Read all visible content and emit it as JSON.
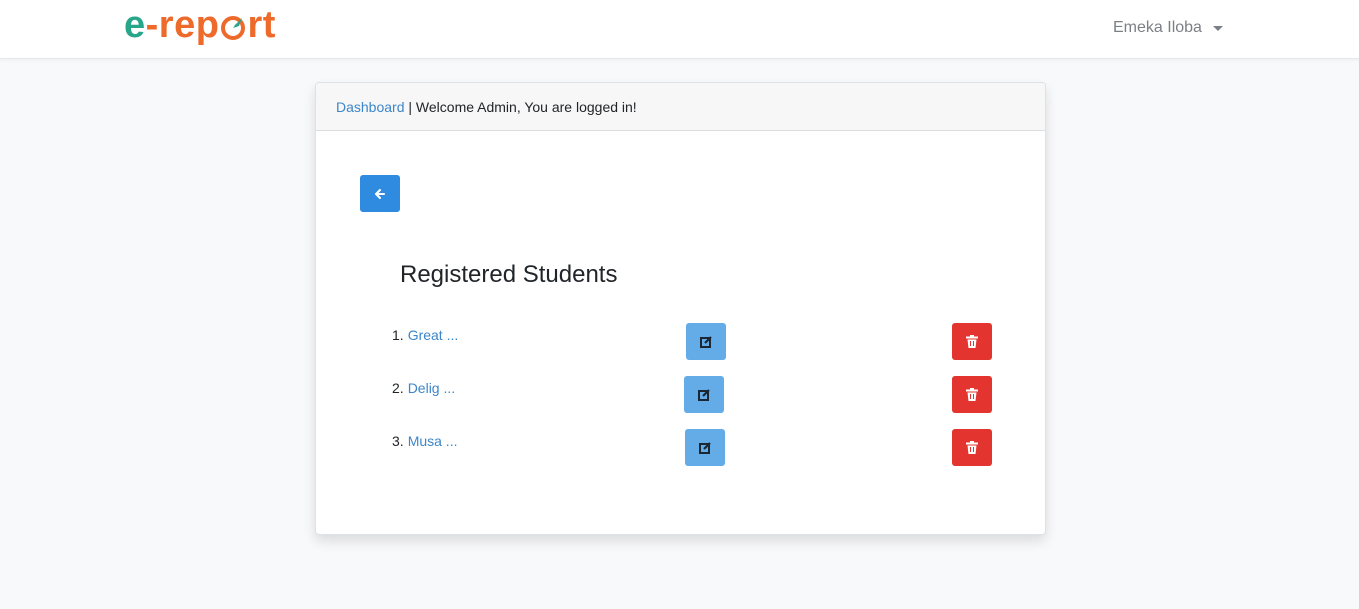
{
  "brand": {
    "logo_part1": "e-rep",
    "logo_part2": "rt",
    "colors": {
      "green": "#27a68a",
      "orange": "#ee6a2b"
    }
  },
  "user_menu": {
    "name": "Emeka Iloba"
  },
  "breadcrumb": {
    "link": "Dashboard",
    "separator": " | ",
    "message": "Welcome Admin, You are logged in!"
  },
  "back_button": {
    "icon": "arrow-left-icon"
  },
  "section": {
    "title": "Registered Students"
  },
  "students": [
    {
      "number": "1.",
      "name": "Great ...",
      "edit_icon": "edit-icon",
      "delete_icon": "trash-icon"
    },
    {
      "number": "2.",
      "name": "Delig ...",
      "edit_icon": "edit-icon",
      "delete_icon": "trash-icon"
    },
    {
      "number": "3.",
      "name": "Musa ...",
      "edit_icon": "edit-icon",
      "delete_icon": "trash-icon"
    }
  ],
  "colors": {
    "primary": "#2f8be0",
    "edit": "#63ace8",
    "danger": "#e3342f",
    "link": "#3d86c9"
  }
}
